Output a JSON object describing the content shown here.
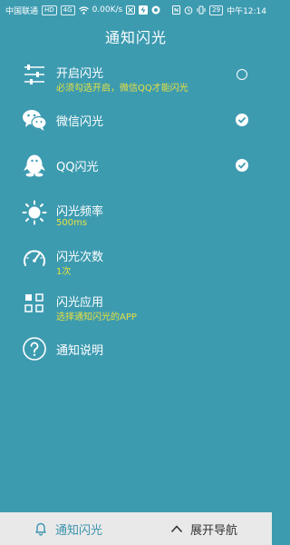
{
  "status_bar": {
    "carrier": "中国联通",
    "net_badge_1": "HD",
    "net_badge_2": "4G",
    "speed": "0.00K/s",
    "battery": "29",
    "time": "中午12:14"
  },
  "header": {
    "title": "通知闪光"
  },
  "rows": [
    {
      "label": "开启闪光",
      "sub": "必须勾选开启，微信QQ才能闪光",
      "icon": "sliders-icon",
      "control": "radio-unchecked"
    },
    {
      "label": "微信闪光",
      "icon": "wechat-icon",
      "control": "check"
    },
    {
      "label": "QQ闪光",
      "icon": "qq-penguin-icon",
      "control": "check"
    },
    {
      "label": "闪光频率",
      "sub": "500ms",
      "icon": "sun-icon"
    },
    {
      "label": "闪光次数",
      "sub": "1次",
      "icon": "speedometer-icon"
    },
    {
      "label": "闪光应用",
      "sub": "选择通知闪光的APP",
      "icon": "apps-grid-icon"
    },
    {
      "label": "通知说明",
      "icon": "help-circle-icon"
    }
  ],
  "bottom_nav": {
    "notify_label": "通知闪光",
    "expand_label": "展开导航"
  },
  "colors": {
    "background": "#3d9bb0",
    "accent_yellow": "#e6e040",
    "bottom_bar": "#e9e9e9",
    "active_tab": "#3a93ad"
  }
}
